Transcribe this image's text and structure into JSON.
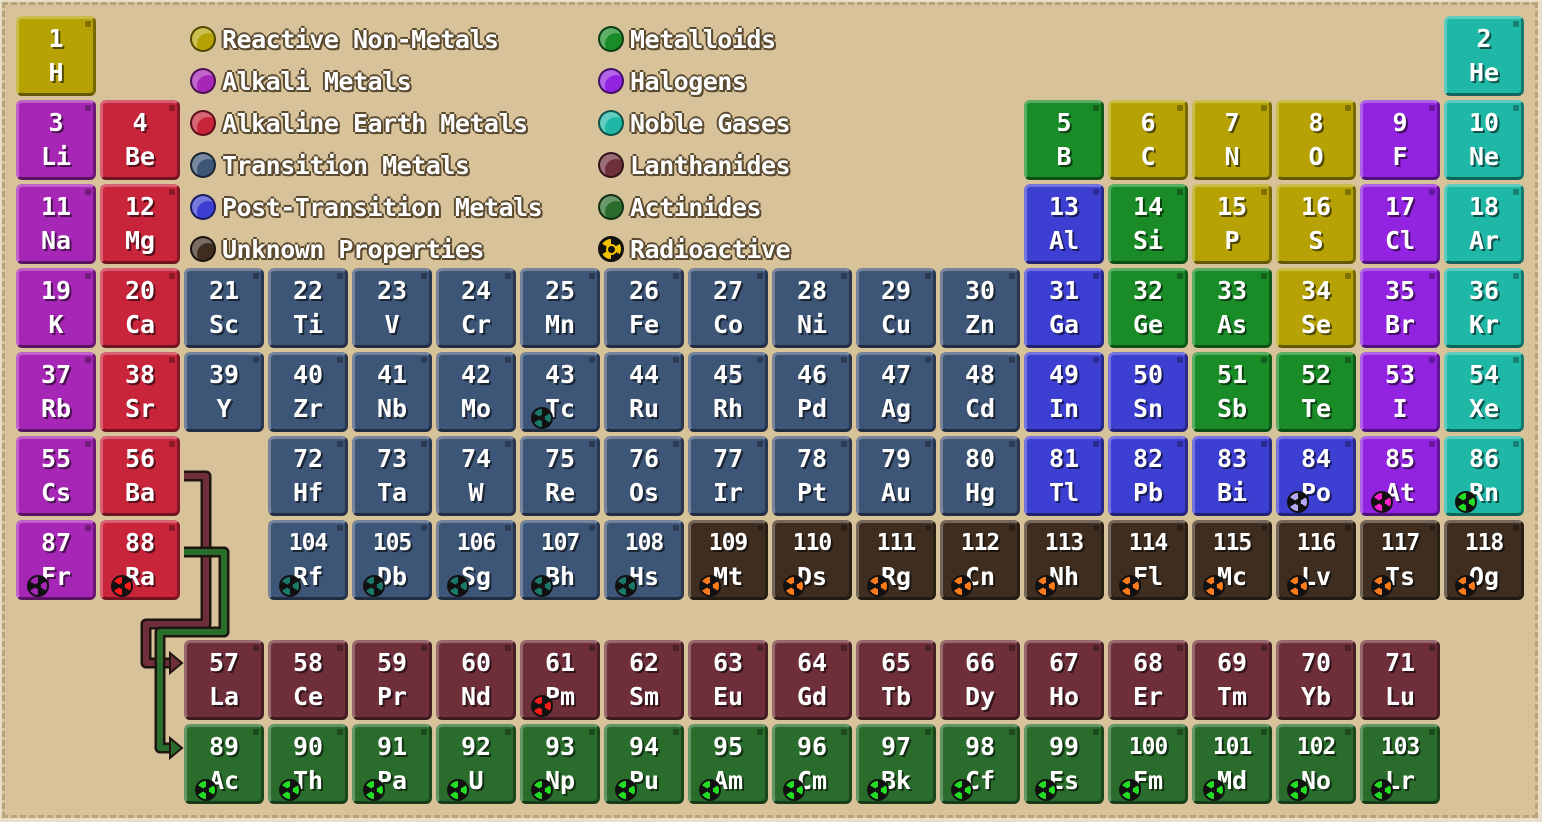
{
  "colors": {
    "reactive": "#b6a204",
    "alkali": "#a626b6",
    "alkaline": "#c8243a",
    "transition": "#3d5577",
    "post": "#3d3fd2",
    "metalloid": "#198c28",
    "halogen": "#9223e0",
    "noble": "#1fb8a6",
    "lanthanide": "#6e2e3a",
    "actinide": "#2a6c2c",
    "unknown": "#3f2e20"
  },
  "legend": [
    {
      "label": "Reactive Non-Metals",
      "category": "reactive"
    },
    {
      "label": "Alkali Metals",
      "category": "alkali"
    },
    {
      "label": "Alkaline Earth Metals",
      "category": "alkaline"
    },
    {
      "label": "Transition Metals",
      "category": "transition"
    },
    {
      "label": "Post-Transition Metals",
      "category": "post"
    },
    {
      "label": "Unknown Properties",
      "category": "unknown"
    },
    {
      "label": "Metalloids",
      "category": "metalloid"
    },
    {
      "label": "Halogens",
      "category": "halogen"
    },
    {
      "label": "Noble Gases",
      "category": "noble"
    },
    {
      "label": "Lanthanides",
      "category": "lanthanide"
    },
    {
      "label": "Actinides",
      "category": "actinide"
    },
    {
      "label": "Radioactive",
      "category": "radioactive"
    }
  ],
  "elements": [
    {
      "n": 1,
      "s": "H",
      "c": "reactive"
    },
    {
      "n": 2,
      "s": "He",
      "c": "noble"
    },
    {
      "n": 3,
      "s": "Li",
      "c": "alkali"
    },
    {
      "n": 4,
      "s": "Be",
      "c": "alkaline"
    },
    {
      "n": 5,
      "s": "B",
      "c": "metalloid"
    },
    {
      "n": 6,
      "s": "C",
      "c": "reactive"
    },
    {
      "n": 7,
      "s": "N",
      "c": "reactive"
    },
    {
      "n": 8,
      "s": "O",
      "c": "reactive"
    },
    {
      "n": 9,
      "s": "F",
      "c": "halogen"
    },
    {
      "n": 10,
      "s": "Ne",
      "c": "noble"
    },
    {
      "n": 11,
      "s": "Na",
      "c": "alkali"
    },
    {
      "n": 12,
      "s": "Mg",
      "c": "alkaline"
    },
    {
      "n": 13,
      "s": "Al",
      "c": "post"
    },
    {
      "n": 14,
      "s": "Si",
      "c": "metalloid"
    },
    {
      "n": 15,
      "s": "P",
      "c": "reactive"
    },
    {
      "n": 16,
      "s": "S",
      "c": "reactive"
    },
    {
      "n": 17,
      "s": "Cl",
      "c": "halogen"
    },
    {
      "n": 18,
      "s": "Ar",
      "c": "noble"
    },
    {
      "n": 19,
      "s": "K",
      "c": "alkali"
    },
    {
      "n": 20,
      "s": "Ca",
      "c": "alkaline"
    },
    {
      "n": 21,
      "s": "Sc",
      "c": "transition"
    },
    {
      "n": 22,
      "s": "Ti",
      "c": "transition"
    },
    {
      "n": 23,
      "s": "V",
      "c": "transition"
    },
    {
      "n": 24,
      "s": "Cr",
      "c": "transition"
    },
    {
      "n": 25,
      "s": "Mn",
      "c": "transition"
    },
    {
      "n": 26,
      "s": "Fe",
      "c": "transition"
    },
    {
      "n": 27,
      "s": "Co",
      "c": "transition"
    },
    {
      "n": 28,
      "s": "Ni",
      "c": "transition"
    },
    {
      "n": 29,
      "s": "Cu",
      "c": "transition"
    },
    {
      "n": 30,
      "s": "Zn",
      "c": "transition"
    },
    {
      "n": 31,
      "s": "Ga",
      "c": "post"
    },
    {
      "n": 32,
      "s": "Ge",
      "c": "metalloid"
    },
    {
      "n": 33,
      "s": "As",
      "c": "metalloid"
    },
    {
      "n": 34,
      "s": "Se",
      "c": "reactive"
    },
    {
      "n": 35,
      "s": "Br",
      "c": "halogen"
    },
    {
      "n": 36,
      "s": "Kr",
      "c": "noble"
    },
    {
      "n": 37,
      "s": "Rb",
      "c": "alkali"
    },
    {
      "n": 38,
      "s": "Sr",
      "c": "alkaline"
    },
    {
      "n": 39,
      "s": "Y",
      "c": "transition"
    },
    {
      "n": 40,
      "s": "Zr",
      "c": "transition"
    },
    {
      "n": 41,
      "s": "Nb",
      "c": "transition"
    },
    {
      "n": 42,
      "s": "Mo",
      "c": "transition"
    },
    {
      "n": 43,
      "s": "Tc",
      "c": "transition",
      "r": "#1a7a6a"
    },
    {
      "n": 44,
      "s": "Ru",
      "c": "transition"
    },
    {
      "n": 45,
      "s": "Rh",
      "c": "transition"
    },
    {
      "n": 46,
      "s": "Pd",
      "c": "transition"
    },
    {
      "n": 47,
      "s": "Ag",
      "c": "transition"
    },
    {
      "n": 48,
      "s": "Cd",
      "c": "transition"
    },
    {
      "n": 49,
      "s": "In",
      "c": "post"
    },
    {
      "n": 50,
      "s": "Sn",
      "c": "post"
    },
    {
      "n": 51,
      "s": "Sb",
      "c": "metalloid"
    },
    {
      "n": 52,
      "s": "Te",
      "c": "metalloid"
    },
    {
      "n": 53,
      "s": "I",
      "c": "halogen"
    },
    {
      "n": 54,
      "s": "Xe",
      "c": "noble"
    },
    {
      "n": 55,
      "s": "Cs",
      "c": "alkali"
    },
    {
      "n": 56,
      "s": "Ba",
      "c": "alkaline"
    },
    {
      "n": 72,
      "s": "Hf",
      "c": "transition"
    },
    {
      "n": 73,
      "s": "Ta",
      "c": "transition"
    },
    {
      "n": 74,
      "s": "W",
      "c": "transition"
    },
    {
      "n": 75,
      "s": "Re",
      "c": "transition"
    },
    {
      "n": 76,
      "s": "Os",
      "c": "transition"
    },
    {
      "n": 77,
      "s": "Ir",
      "c": "transition"
    },
    {
      "n": 78,
      "s": "Pt",
      "c": "transition"
    },
    {
      "n": 79,
      "s": "Au",
      "c": "transition"
    },
    {
      "n": 80,
      "s": "Hg",
      "c": "transition"
    },
    {
      "n": 81,
      "s": "Tl",
      "c": "post"
    },
    {
      "n": 82,
      "s": "Pb",
      "c": "post"
    },
    {
      "n": 83,
      "s": "Bi",
      "c": "post"
    },
    {
      "n": 84,
      "s": "Po",
      "c": "post",
      "r": "#b7a6f0"
    },
    {
      "n": 85,
      "s": "At",
      "c": "halogen",
      "r": "#ff22cc"
    },
    {
      "n": 86,
      "s": "Rn",
      "c": "noble",
      "r": "#22dd22"
    },
    {
      "n": 87,
      "s": "Fr",
      "c": "alkali",
      "r": "#a626b6"
    },
    {
      "n": 88,
      "s": "Ra",
      "c": "alkaline",
      "r": "#ff1a1a"
    },
    {
      "n": 104,
      "s": "Rf",
      "c": "transition",
      "r": "#1a7a6a"
    },
    {
      "n": 105,
      "s": "Db",
      "c": "transition",
      "r": "#1a7a6a"
    },
    {
      "n": 106,
      "s": "Sg",
      "c": "transition",
      "r": "#1a7a6a"
    },
    {
      "n": 107,
      "s": "Bh",
      "c": "transition",
      "r": "#1a7a6a"
    },
    {
      "n": 108,
      "s": "Hs",
      "c": "transition",
      "r": "#1a7a6a"
    },
    {
      "n": 109,
      "s": "Mt",
      "c": "unknown",
      "r": "#ff7a1a"
    },
    {
      "n": 110,
      "s": "Ds",
      "c": "unknown",
      "r": "#ff7a1a"
    },
    {
      "n": 111,
      "s": "Rg",
      "c": "unknown",
      "r": "#ff7a1a"
    },
    {
      "n": 112,
      "s": "Cn",
      "c": "unknown",
      "r": "#ff7a1a"
    },
    {
      "n": 113,
      "s": "Nh",
      "c": "unknown",
      "r": "#ff7a1a"
    },
    {
      "n": 114,
      "s": "Fl",
      "c": "unknown",
      "r": "#ff7a1a"
    },
    {
      "n": 115,
      "s": "Mc",
      "c": "unknown",
      "r": "#ff7a1a"
    },
    {
      "n": 116,
      "s": "Lv",
      "c": "unknown",
      "r": "#ff7a1a"
    },
    {
      "n": 117,
      "s": "Ts",
      "c": "unknown",
      "r": "#ff7a1a"
    },
    {
      "n": 118,
      "s": "Og",
      "c": "unknown",
      "r": "#ff7a1a"
    },
    {
      "n": 57,
      "s": "La",
      "c": "lanthanide"
    },
    {
      "n": 58,
      "s": "Ce",
      "c": "lanthanide"
    },
    {
      "n": 59,
      "s": "Pr",
      "c": "lanthanide"
    },
    {
      "n": 60,
      "s": "Nd",
      "c": "lanthanide"
    },
    {
      "n": 61,
      "s": "Pm",
      "c": "lanthanide",
      "r": "#ff1a1a"
    },
    {
      "n": 62,
      "s": "Sm",
      "c": "lanthanide"
    },
    {
      "n": 63,
      "s": "Eu",
      "c": "lanthanide"
    },
    {
      "n": 64,
      "s": "Gd",
      "c": "lanthanide"
    },
    {
      "n": 65,
      "s": "Tb",
      "c": "lanthanide"
    },
    {
      "n": 66,
      "s": "Dy",
      "c": "lanthanide"
    },
    {
      "n": 67,
      "s": "Ho",
      "c": "lanthanide"
    },
    {
      "n": 68,
      "s": "Er",
      "c": "lanthanide"
    },
    {
      "n": 69,
      "s": "Tm",
      "c": "lanthanide"
    },
    {
      "n": 70,
      "s": "Yb",
      "c": "lanthanide"
    },
    {
      "n": 71,
      "s": "Lu",
      "c": "lanthanide"
    },
    {
      "n": 89,
      "s": "Ac",
      "c": "actinide",
      "r": "#22dd22"
    },
    {
      "n": 90,
      "s": "Th",
      "c": "actinide",
      "r": "#22dd22"
    },
    {
      "n": 91,
      "s": "Pa",
      "c": "actinide",
      "r": "#22dd22"
    },
    {
      "n": 92,
      "s": "U",
      "c": "actinide",
      "r": "#22dd22"
    },
    {
      "n": 93,
      "s": "Np",
      "c": "actinide",
      "r": "#22dd22"
    },
    {
      "n": 94,
      "s": "Pu",
      "c": "actinide",
      "r": "#22dd22"
    },
    {
      "n": 95,
      "s": "Am",
      "c": "actinide",
      "r": "#22dd22"
    },
    {
      "n": 96,
      "s": "Cm",
      "c": "actinide",
      "r": "#22dd22"
    },
    {
      "n": 97,
      "s": "Bk",
      "c": "actinide",
      "r": "#22dd22"
    },
    {
      "n": 98,
      "s": "Cf",
      "c": "actinide",
      "r": "#22dd22"
    },
    {
      "n": 99,
      "s": "Es",
      "c": "actinide",
      "r": "#22dd22"
    },
    {
      "n": 100,
      "s": "Fm",
      "c": "actinide",
      "r": "#22dd22"
    },
    {
      "n": 101,
      "s": "Md",
      "c": "actinide",
      "r": "#22dd22"
    },
    {
      "n": 102,
      "s": "No",
      "c": "actinide",
      "r": "#22dd22"
    },
    {
      "n": 103,
      "s": "Lr",
      "c": "actinide",
      "r": "#22dd22"
    }
  ]
}
